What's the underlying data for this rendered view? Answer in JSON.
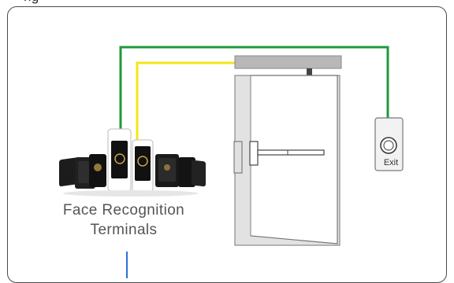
{
  "header": {
    "title_fragment": "ng"
  },
  "terminal": {
    "label_line1": "Face Recognition",
    "label_line2": "Terminals"
  },
  "exit_button": {
    "label": "Exit"
  },
  "colors": {
    "green_wire": "#1f9a3c",
    "yellow_wire": "#f5e616",
    "blue_wire": "#2a6fd6",
    "frame": "#4a4a4a",
    "door_header": "#b8b8b8"
  },
  "icons": [
    "face-terminal-icon",
    "exit-button-icon",
    "push-bar-icon",
    "door-closer-icon"
  ]
}
